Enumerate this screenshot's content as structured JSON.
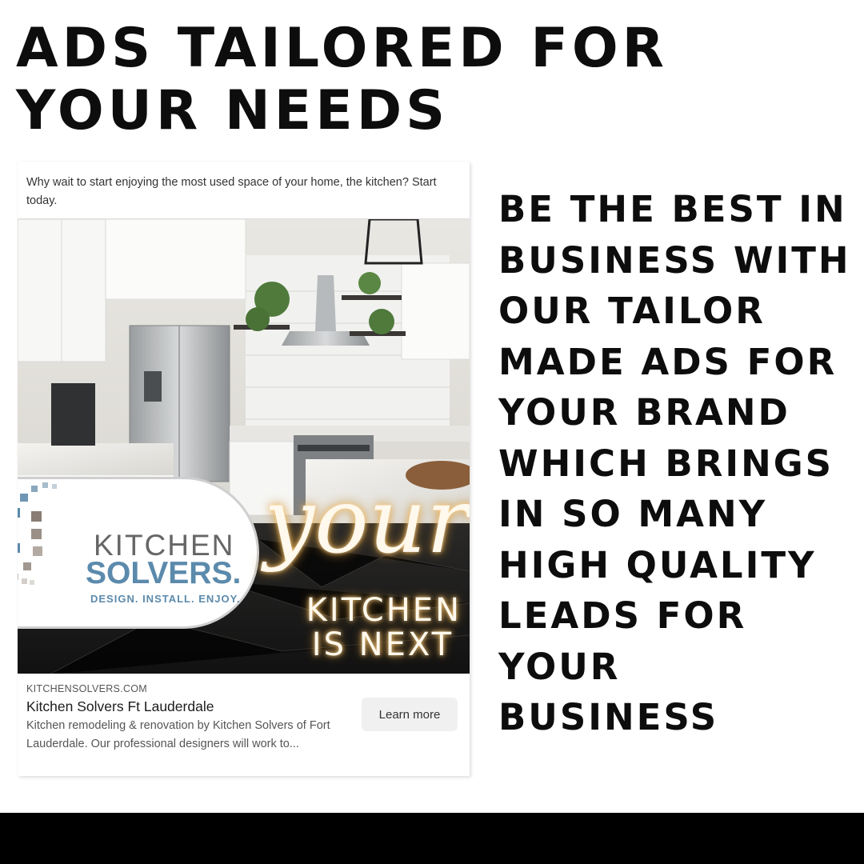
{
  "headline": {
    "line1": "ADS TAILORED FOR",
    "line2": "YOUR NEEDS"
  },
  "side_copy": {
    "lines": [
      "BE THE BEST IN",
      "BUSINESS WITH",
      "OUR TAILOR",
      "MADE ADS FOR",
      "YOUR BRAND",
      "WHICH BRINGS",
      "IN SO MANY",
      "HIGH QUALITY",
      "LEADS FOR",
      "YOUR",
      "BUSINESS"
    ]
  },
  "ad": {
    "primary_text": "Why wait to start enjoying the most used space of your home, the kitchen? Start today.",
    "image": {
      "logo_line1": "KITCHEN",
      "logo_line2": "SOLVERS.",
      "logo_tagline": "DESIGN. INSTALL. ENJOY.",
      "overlay_script": "your",
      "overlay_line1": "KITCHEN",
      "overlay_line2": "IS NEXT"
    },
    "domain": "KITCHENSOLVERS.COM",
    "title": "Kitchen Solvers Ft Lauderdale",
    "description": "Kitchen remodeling & renovation by Kitchen Solvers of Fort Lauderdale. Our professional designers will work to...",
    "cta_label": "Learn more"
  },
  "colors": {
    "text": "#0d0d0d",
    "brand_blue": "#5b8aac",
    "bottom_bar": "#000000"
  }
}
